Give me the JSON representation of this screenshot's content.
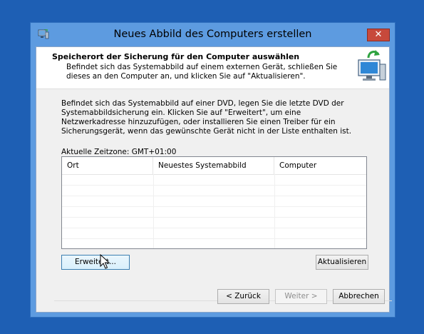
{
  "window": {
    "title": "Neues Abbild des Computers erstellen",
    "close_symbol": "✕"
  },
  "header": {
    "title": "Speicherort der Sicherung für den Computer auswählen",
    "description": "Befindet sich das Systemabbild auf einem externen Gerät, schließen Sie dieses an den Computer an, und klicken Sie auf \"Aktualisieren\"."
  },
  "body": {
    "instructions": "Befindet sich das Systemabbild auf einer DVD, legen Sie die letzte DVD der Systemabbildsicherung ein. Klicken Sie auf \"Erweitert\", um eine Netzwerkadresse hinzuzufügen, oder installieren Sie einen Treiber für ein Sicherungsgerät, wenn das gewünschte Gerät nicht in der Liste enthalten ist.",
    "timezone_label": "Aktuelle Zeitzone: GMT+01:00"
  },
  "list": {
    "columns": [
      "Ort",
      "Neuestes Systemabbild",
      "Computer"
    ],
    "rows": []
  },
  "buttons": {
    "advanced": "Erweitert...",
    "refresh": "Aktualisieren",
    "back": "< Zurück",
    "next": "Weiter >",
    "cancel": "Abbrechen"
  },
  "icons": {
    "title_icon": "computer-backup-icon",
    "header_icon": "computer-restore-icon",
    "cursor": "mouse-pointer-icon"
  },
  "colors": {
    "desktop": "#1e5fb4",
    "window_frame": "#5d9be0",
    "close_button": "#c7493b"
  }
}
